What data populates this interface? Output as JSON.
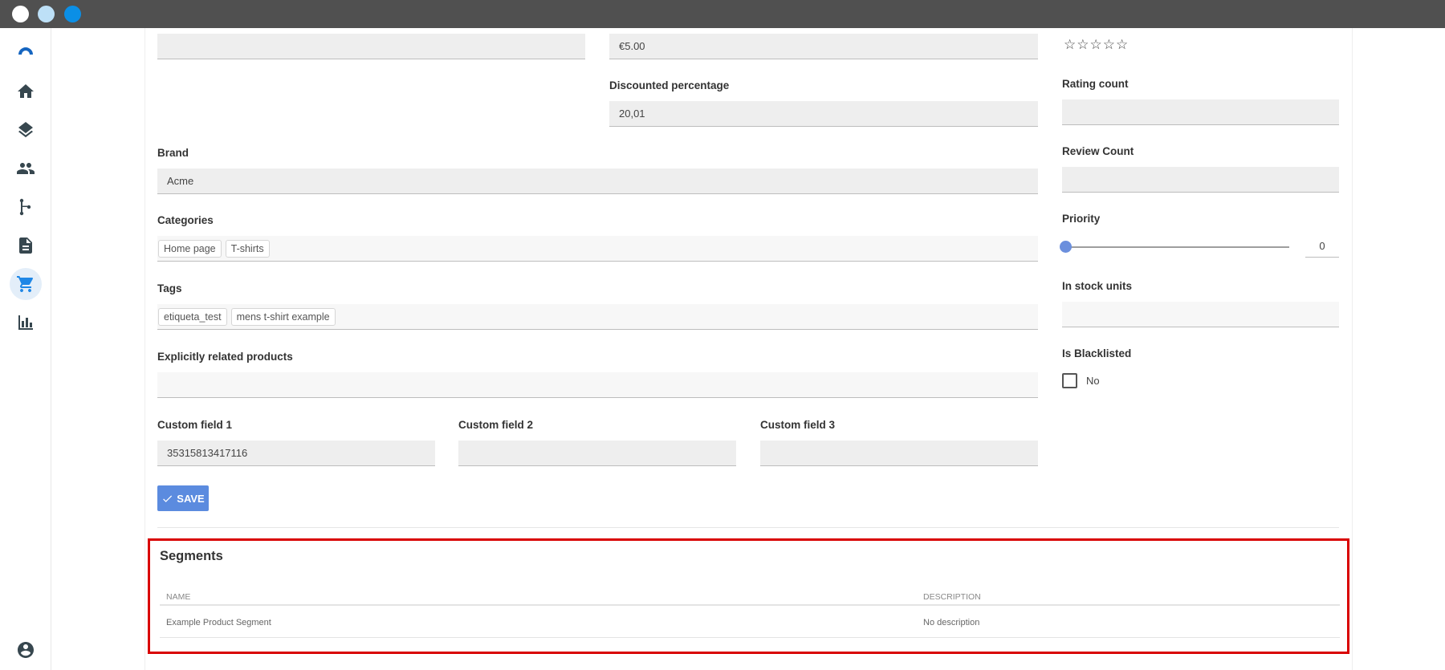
{
  "window": {
    "controls": [
      "close",
      "minimize",
      "maximize"
    ]
  },
  "sidebar": {
    "items": [
      {
        "name": "logo",
        "icon": "app-logo-icon"
      },
      {
        "name": "home",
        "icon": "home-icon"
      },
      {
        "name": "layers",
        "icon": "layers-icon"
      },
      {
        "name": "people",
        "icon": "people-icon"
      },
      {
        "name": "flow",
        "icon": "branch-icon"
      },
      {
        "name": "documents",
        "icon": "document-icon"
      },
      {
        "name": "cart",
        "icon": "cart-icon",
        "active": true
      },
      {
        "name": "analytics",
        "icon": "bar-chart-icon"
      },
      {
        "name": "account",
        "icon": "account-circle-icon"
      }
    ],
    "active_color": "#1f87e6"
  },
  "form": {
    "top_left_value": "",
    "price": {
      "value": "€5.00"
    },
    "rating": {
      "stars": "☆☆☆☆☆",
      "filled": 0,
      "max": 5
    },
    "discounted_percentage": {
      "label": "Discounted percentage",
      "value": "20,01"
    },
    "rating_count": {
      "label": "Rating count",
      "value": ""
    },
    "brand": {
      "label": "Brand",
      "value": "Acme"
    },
    "review_count": {
      "label": "Review Count",
      "value": ""
    },
    "categories": {
      "label": "Categories",
      "chips": [
        "Home page",
        "T-shirts"
      ]
    },
    "priority": {
      "label": "Priority",
      "value": "0",
      "slider_fraction": 0
    },
    "tags": {
      "label": "Tags",
      "chips": [
        "etiqueta_test",
        "mens t-shirt example"
      ]
    },
    "in_stock_units": {
      "label": "In stock units",
      "value": ""
    },
    "explicitly_related": {
      "label": "Explicitly related products",
      "value": ""
    },
    "is_blacklisted": {
      "label": "Is Blacklisted",
      "checked": false,
      "option_label": "No"
    },
    "custom_field_1": {
      "label": "Custom field 1",
      "value": "35315813417116"
    },
    "custom_field_2": {
      "label": "Custom field 2",
      "value": ""
    },
    "custom_field_3": {
      "label": "Custom field 3",
      "value": ""
    },
    "save_label": "SAVE",
    "save_color": "#5b8bdf"
  },
  "segments": {
    "title": "Segments",
    "highlight_color": "#d90000",
    "columns": [
      "NAME",
      "DESCRIPTION"
    ],
    "rows": [
      {
        "name": "Example Product Segment",
        "description": "No description"
      }
    ]
  }
}
